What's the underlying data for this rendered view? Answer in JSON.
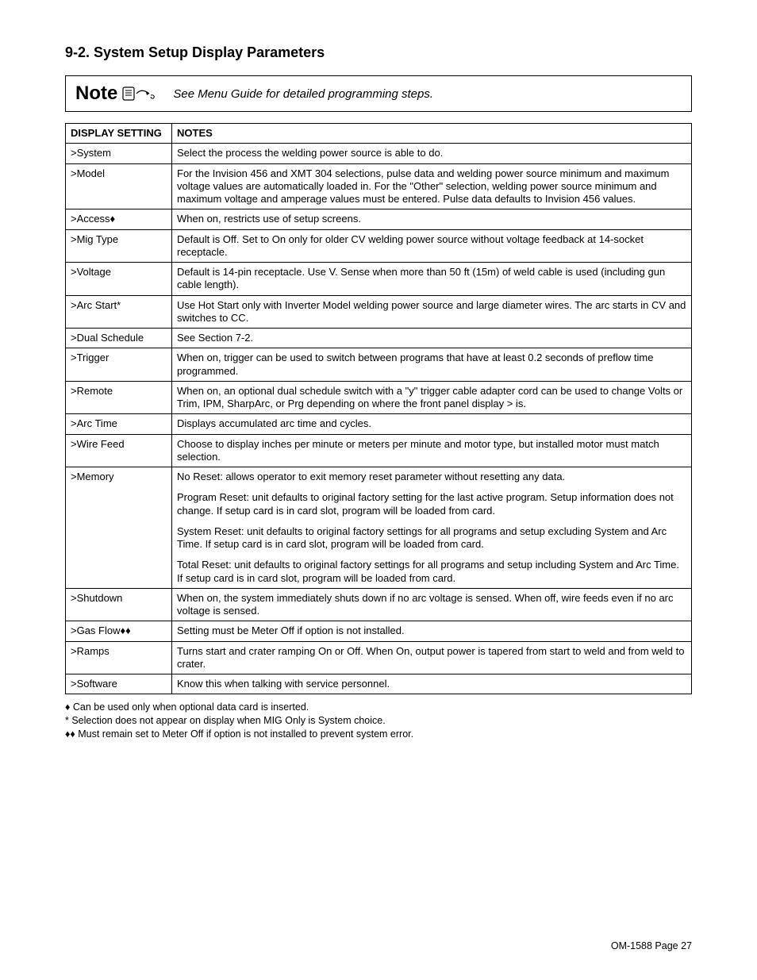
{
  "heading": "9-2.   System Setup Display Parameters",
  "note": {
    "label": "Note",
    "text": "See Menu Guide for detailed programming steps."
  },
  "table": {
    "headers": {
      "setting": "DISPLAY SETTING",
      "notes": "NOTES"
    },
    "rows": [
      {
        "setting": ">System",
        "notes": "Select the process the welding power source is able to do."
      },
      {
        "setting": ">Model",
        "notes": "For the Invision 456 and XMT 304 selections, pulse data and welding power source minimum and maximum voltage values are automatically loaded in. For the \"Other\" selection, welding power source minimum and maximum voltage and amperage values must be entered. Pulse data defaults to Invision 456 values."
      },
      {
        "setting": ">Access♦",
        "notes": "When on, restricts use of setup screens."
      },
      {
        "setting": ">Mig Type",
        "notes": "Default is Off. Set to On only for older CV welding power source without voltage feedback at 14-socket receptacle."
      },
      {
        "setting": ">Voltage",
        "notes": "Default is 14-pin receptacle. Use V. Sense when more than 50 ft (15m) of weld cable is used (including gun cable length)."
      },
      {
        "setting": ">Arc Start*",
        "notes": "Use Hot Start only with Inverter Model welding power source and large diameter wires. The arc starts in CV and switches to CC."
      },
      {
        "setting": ">Dual Schedule",
        "notes": "See Section 7-2."
      },
      {
        "setting": ">Trigger",
        "notes": "When on, trigger can be used to switch between programs that have at least 0.2 seconds of preflow time programmed."
      },
      {
        "setting": ">Remote",
        "notes": "When on, an optional dual schedule switch with a  \"y\" trigger cable adapter cord can be used to change Volts or Trim, IPM, SharpArc, or Prg depending on where the front panel display > is."
      },
      {
        "setting": ">Arc Time",
        "notes": "Displays accumulated arc time and cycles."
      },
      {
        "setting": ">Wire Feed",
        "notes": "Choose to display inches per minute or meters per minute and motor type, but installed motor must match selection."
      }
    ],
    "memory": {
      "setting": ">Memory",
      "p1": "No Reset: allows operator to exit memory reset parameter without resetting any data.",
      "p2": "Program Reset: unit defaults to original factory setting for the last active program. Setup information does not change. If setup card is in card slot, program will be loaded from card.",
      "p3": "System Reset: unit defaults to original factory settings for all programs and setup excluding System and Arc Time. If setup card is in card slot, program will be loaded from card.",
      "p4": "Total Reset: unit defaults to original factory settings for all programs and setup including System and Arc Time. If setup card is in card slot, program will be loaded from card."
    },
    "rows2": [
      {
        "setting": ">Shutdown",
        "notes": "When on, the system immediately shuts down if no arc voltage is sensed. When off, wire feeds even if no arc voltage is sensed."
      },
      {
        "setting": ">Gas Flow♦♦",
        "notes": "Setting must be Meter Off if option is not installed."
      },
      {
        "setting": ">Ramps",
        "notes": "Turns start and crater ramping On or Off. When On, output power is tapered from start to weld and from weld to crater."
      },
      {
        "setting": ">Software",
        "notes": "Know this when talking with service personnel."
      }
    ]
  },
  "footnotes": {
    "f1": "♦ Can be used only when optional data card is inserted.",
    "f2": "* Selection does not appear on display when MIG Only is System choice.",
    "f3": "♦♦ Must remain set to Meter Off if option is not installed to prevent system error."
  },
  "footer": "OM-1588 Page 27"
}
